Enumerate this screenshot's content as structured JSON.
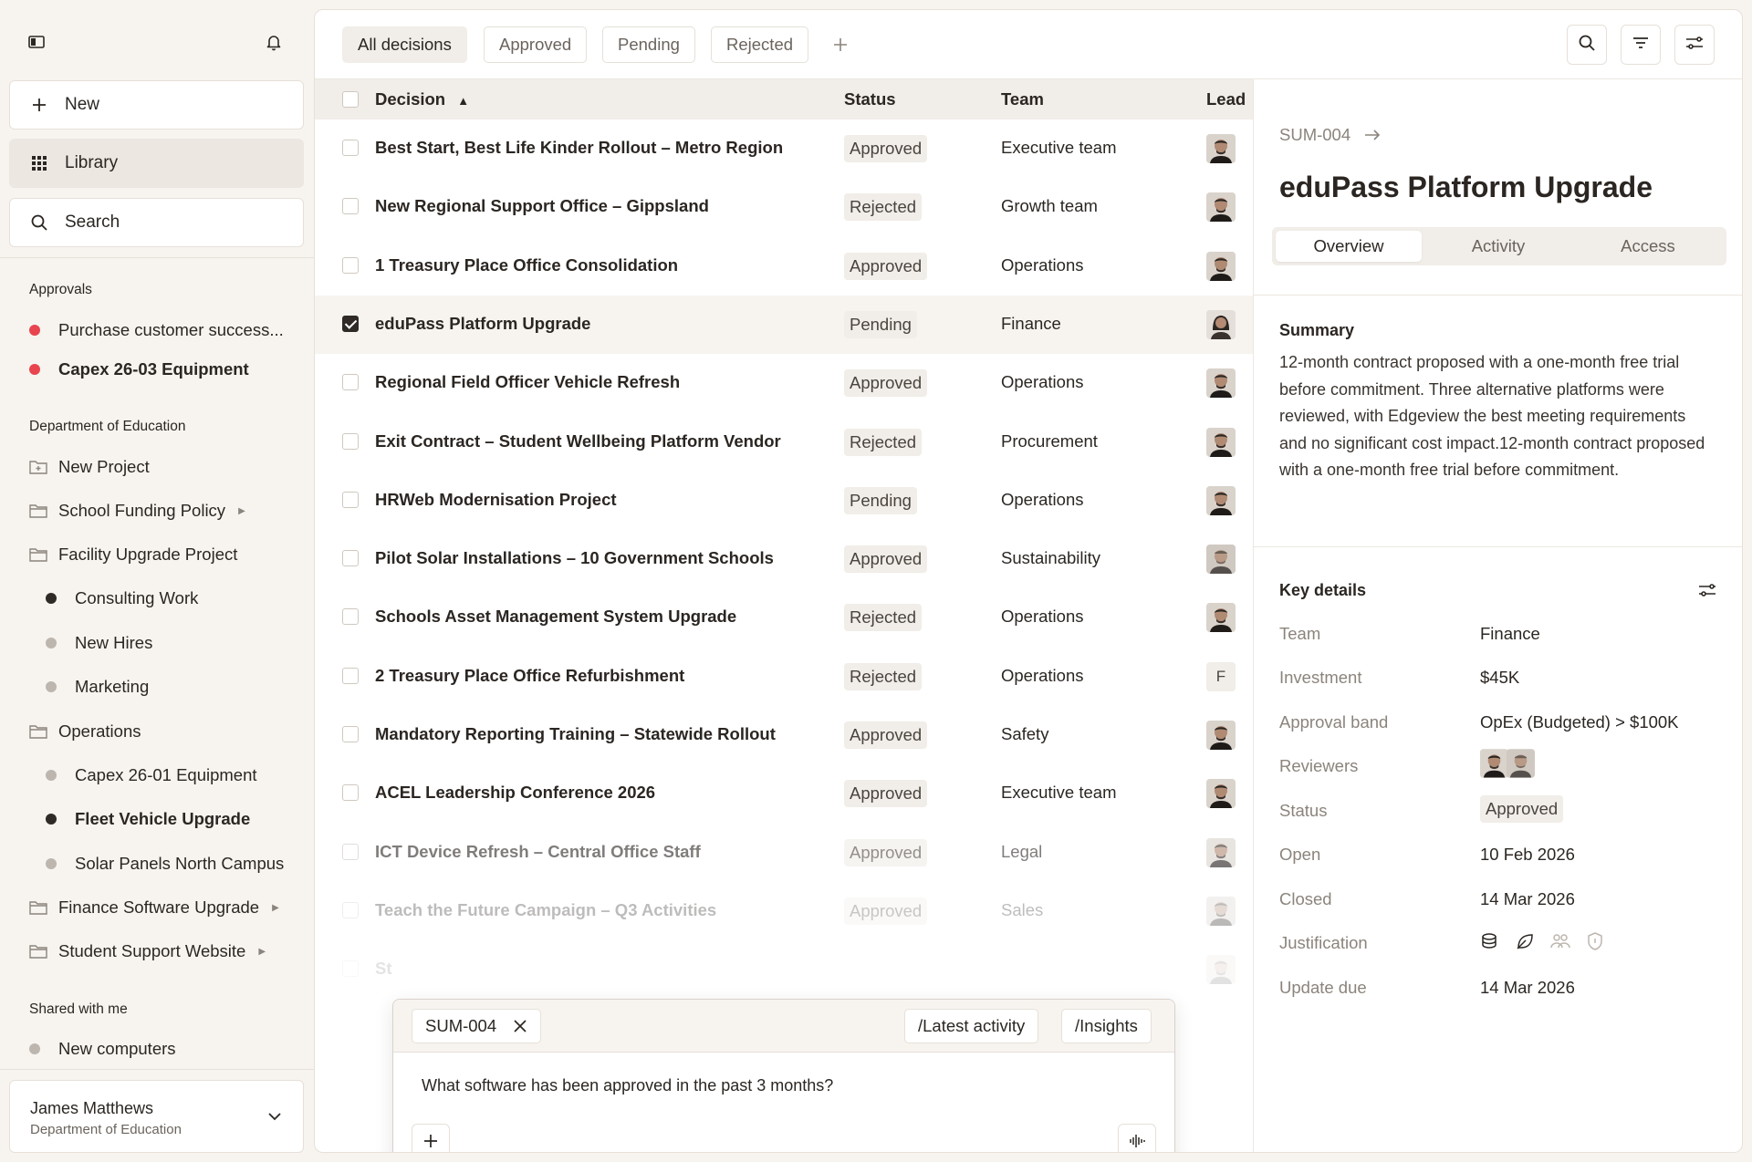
{
  "sidebar": {
    "new_label": "New",
    "library_label": "Library",
    "search_label": "Search",
    "approvals_heading": "Approvals",
    "approvals": [
      "Purchase customer success...",
      "Capex 26-03 Equipment"
    ],
    "dept_heading": "Department of Education",
    "dept_items": [
      "New Project",
      "School Funding Policy",
      "Facility Upgrade Project",
      "Consulting Work",
      "New Hires",
      "Marketing",
      "Operations",
      "Capex 26-01 Equipment",
      "Fleet Vehicle Upgrade",
      "Solar Panels North Campus",
      "Finance Software Upgrade",
      "Student Support Website"
    ],
    "shared_heading": "Shared with me",
    "shared_items": [
      "New computers"
    ],
    "user": {
      "name": "James Matthews",
      "org": "Department of Education"
    }
  },
  "filters": {
    "tabs": [
      "All decisions",
      "Approved",
      "Pending",
      "Rejected"
    ]
  },
  "table": {
    "headers": {
      "decision": "Decision",
      "sort_icon": "▲",
      "status": "Status",
      "team": "Team",
      "lead": "Lead"
    },
    "rows": [
      {
        "decision": "Best Start, Best Life Kinder Rollout – Metro Region",
        "status": "Approved",
        "team": "Executive team"
      },
      {
        "decision": "New Regional Support Office – Gippsland",
        "status": "Rejected",
        "team": "Growth team"
      },
      {
        "decision": "1 Treasury Place Office Consolidation",
        "status": "Approved",
        "team": "Operations"
      },
      {
        "decision": "eduPass Platform Upgrade",
        "status": "Pending",
        "team": "Finance"
      },
      {
        "decision": "Regional Field Officer Vehicle Refresh",
        "status": "Approved",
        "team": "Operations"
      },
      {
        "decision": "Exit Contract – Student Wellbeing Platform Vendor",
        "status": "Rejected",
        "team": "Procurement"
      },
      {
        "decision": "HRWeb Modernisation Project",
        "status": "Pending",
        "team": "Operations"
      },
      {
        "decision": "Pilot Solar Installations – 10 Government Schools",
        "status": "Approved",
        "team": "Sustainability"
      },
      {
        "decision": "Schools Asset Management System Upgrade",
        "status": "Rejected",
        "team": "Operations"
      },
      {
        "decision": "2 Treasury Place Office Refurbishment",
        "status": "Rejected",
        "team": "Operations",
        "lead_letter": "F"
      },
      {
        "decision": "Mandatory Reporting Training – Statewide Rollout",
        "status": "Approved",
        "team": "Safety"
      },
      {
        "decision": "ACEL Leadership Conference 2026",
        "status": "Approved",
        "team": "Executive team"
      },
      {
        "decision": "ICT Device Refresh – Central Office Staff",
        "status": "Approved",
        "team": "Legal"
      },
      {
        "decision": "Teach the Future Campaign – Q3 Activities",
        "status": "Approved",
        "team": "Sales"
      },
      {
        "decision": "St",
        "status": "",
        "team": ""
      }
    ]
  },
  "chat": {
    "chip_id": "SUM-004",
    "cmd_latest": "/Latest activity",
    "cmd_insights": "/Insights",
    "question": "What software has been approved in the past 3 months?"
  },
  "detail": {
    "id": "SUM-004",
    "title": "eduPass Platform Upgrade",
    "tabs": [
      "Overview",
      "Activity",
      "Access"
    ],
    "summary_heading": "Summary",
    "summary": "12-month contract proposed with a one-month free trial before commitment. Three alternative platforms were reviewed, with Edgeview the best meeting requirements and no significant cost impact.12-month contract proposed with a one-month free trial before commitment.",
    "key_heading": "Key details",
    "keys": {
      "team_k": "Team",
      "team_v": "Finance",
      "investment_k": "Investment",
      "investment_v": "$45K",
      "band_k": "Approval band",
      "band_v": "OpEx (Budgeted) > $100K",
      "reviewers_k": "Reviewers",
      "status_k": "Status",
      "status_v": "Approved",
      "open_k": "Open",
      "open_v": "10 Feb 2026",
      "closed_k": "Closed",
      "closed_v": "14 Mar 2026",
      "just_k": "Justification",
      "update_k": "Update due",
      "update_v": "14 Mar 2026"
    }
  },
  "colors": {
    "accent_red": "#e8454f",
    "selected_bg": "#f7f4f0",
    "badge_bg": "#f1ede8"
  }
}
